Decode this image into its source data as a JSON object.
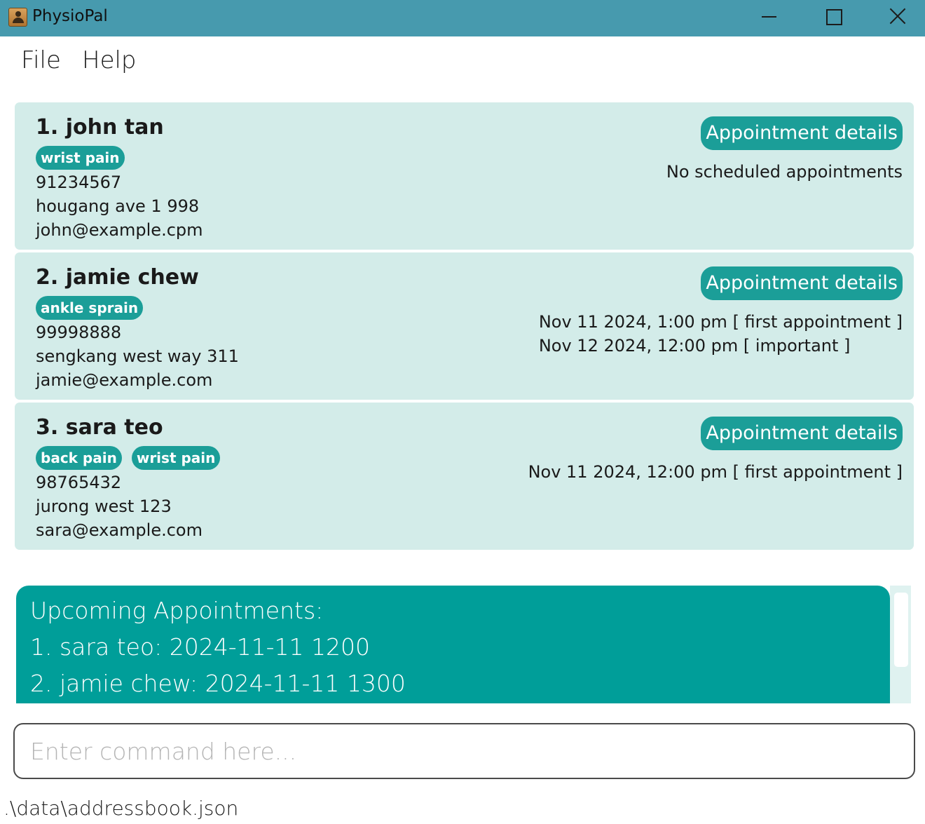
{
  "window": {
    "title": "PhysioPal",
    "app_icon": "contact-card-icon",
    "controls": [
      "minimize-icon",
      "maximize-icon",
      "close-icon"
    ]
  },
  "menu": {
    "file": "File",
    "help": "Help"
  },
  "patients": [
    {
      "name": "1. john tan",
      "tags": [
        "wrist pain"
      ],
      "phone": "91234567",
      "address": "hougang ave 1 998",
      "email": "john@example.cpm",
      "appointment_button": "Appointment details",
      "appointments": [
        "No scheduled appointments"
      ]
    },
    {
      "name": "2. jamie chew",
      "tags": [
        "ankle sprain"
      ],
      "phone": "99998888",
      "address": "sengkang west way 311",
      "email": "jamie@example.com",
      "appointment_button": "Appointment details",
      "appointments": [
        "Nov 11 2024, 1:00 pm [ first appointment ]",
        "Nov 12 2024, 12:00 pm [ important ]"
      ]
    },
    {
      "name": "3. sara teo",
      "tags": [
        "back pain",
        "wrist pain"
      ],
      "phone": "98765432",
      "address": "jurong west 123",
      "email": "sara@example.com",
      "appointment_button": "Appointment details",
      "appointments": [
        "Nov 11 2024, 12:00 pm [ first appointment ]"
      ]
    }
  ],
  "upcoming": {
    "heading": "Upcoming Appointments:",
    "items": [
      "1. sara teo: 2024-11-11 1200",
      "2. jamie chew: 2024-11-11 1300"
    ]
  },
  "command": {
    "value": "",
    "placeholder": "Enter command here..."
  },
  "status": {
    "file_path": ".\\data\\addressbook.json"
  },
  "colors": {
    "title_bar": "#479aae",
    "card_bg": "#d3ece9",
    "accent": "#1b9e98",
    "upcoming_bg": "#009e99"
  }
}
